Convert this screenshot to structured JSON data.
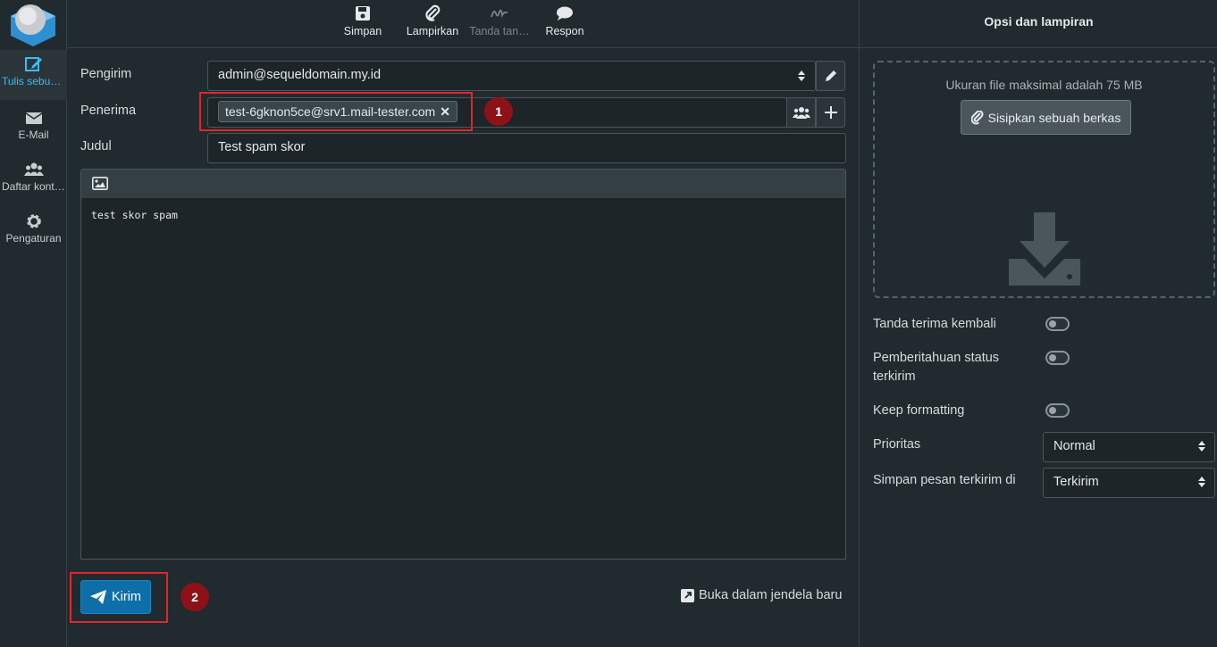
{
  "nav": {
    "items": [
      {
        "label": "Tulis sebuah pesan",
        "icon": "compose-icon"
      },
      {
        "label": "E-Mail",
        "icon": "envelope-icon"
      },
      {
        "label": "Daftar kontak",
        "icon": "contacts-icon"
      },
      {
        "label": "Pengaturan",
        "icon": "gear-icon"
      }
    ]
  },
  "toolbar": {
    "save": "Simpan",
    "attach": "Lampirkan",
    "signature": "Tanda tan…",
    "responses": "Respon"
  },
  "form": {
    "from_label": "Pengirim",
    "from_value": "admin@sequeldomain.my.id",
    "to_label": "Penerima",
    "to_recipient": "test-6gknon5ce@srv1.mail-tester.com",
    "subject_label": "Judul",
    "subject_value": "Test spam skor",
    "body": "test skor spam"
  },
  "actions": {
    "send": "Kirim",
    "open_new_window": "Buka dalam jendela baru"
  },
  "annotations": {
    "marker1": "1",
    "marker2": "2"
  },
  "panel": {
    "title": "Opsi dan lampiran",
    "max_size": "Ukuran file maksimal adalah 75 MB",
    "attach_button": "Sisipkan sebuah berkas",
    "options": {
      "return_receipt": "Tanda terima kembali",
      "dsn": "Pemberitahuan status terkirim",
      "keep_formatting": "Keep formatting",
      "priority_label": "Prioritas",
      "priority_value": "Normal",
      "save_sent_label": "Simpan pesan terkirim di",
      "save_sent_value": "Terkirim"
    }
  },
  "colors": {
    "accent": "#37beff",
    "send": "#0e6ea8",
    "highlight": "#e0262b",
    "marker": "#8e1118"
  }
}
